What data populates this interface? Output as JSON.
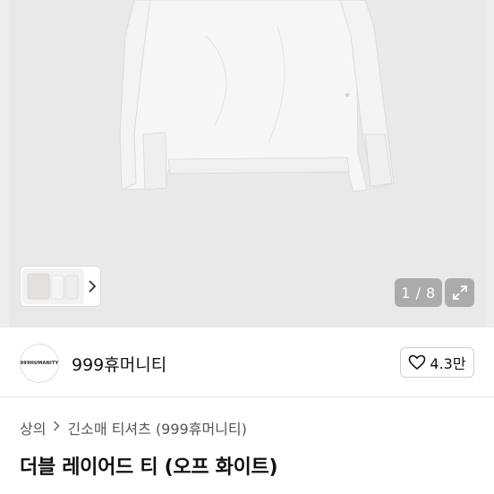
{
  "gallery": {
    "counter": "1 / 8",
    "thumb_arrow": "›"
  },
  "seller": {
    "name": "999휴머니티",
    "avatar_text": "999HUMANITY",
    "likes": "4.3만"
  },
  "breadcrumb": {
    "category": "상의",
    "subcategory": "긴소매 티셔츠 (999휴머니티)"
  },
  "product": {
    "title": "더블 레이어드 티 (오프 화이트)"
  },
  "colors": {
    "gallery_bg": "#e9e9e9",
    "overlay": "rgba(120,120,120,0.55)"
  },
  "icons": {
    "expand": "expand-icon",
    "heart": "heart-icon",
    "chevron": "chevron-right-icon"
  }
}
